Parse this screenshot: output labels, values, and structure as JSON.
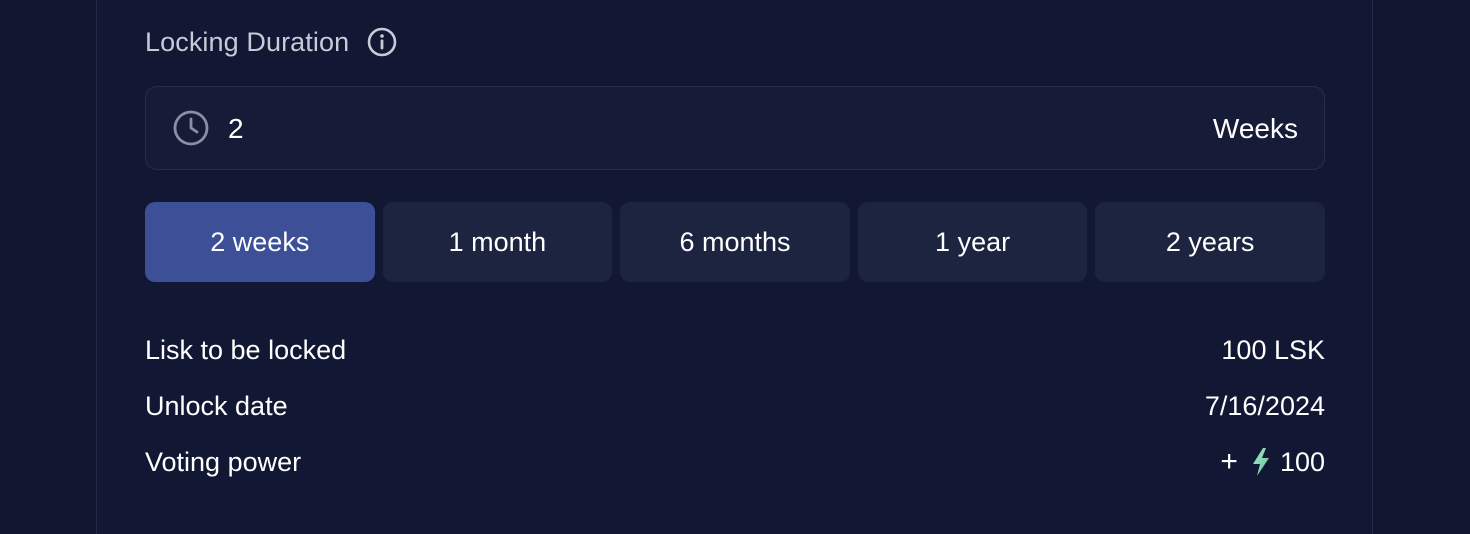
{
  "locking": {
    "label": "Locking Duration",
    "info_icon": "info-icon",
    "input": {
      "icon": "clock-icon",
      "value": "2",
      "unit": "Weeks"
    },
    "presets": [
      {
        "label": "2 weeks",
        "selected": true
      },
      {
        "label": "1 month",
        "selected": false
      },
      {
        "label": "6 months",
        "selected": false
      },
      {
        "label": "1 year",
        "selected": false
      },
      {
        "label": "2 years",
        "selected": false
      }
    ]
  },
  "summary": {
    "lisk_label": "Lisk to be locked",
    "lisk_value": "100 LSK",
    "unlock_label": "Unlock date",
    "unlock_value": "7/16/2024",
    "voting_label": "Voting power",
    "voting_prefix": "+",
    "voting_icon": "lightning-icon",
    "voting_value": "100"
  },
  "colors": {
    "background": "#101530",
    "field": "#161c38",
    "preset": "#1d2440",
    "preset_active": "#3c4f97",
    "bolt": "#7fd6a8"
  }
}
